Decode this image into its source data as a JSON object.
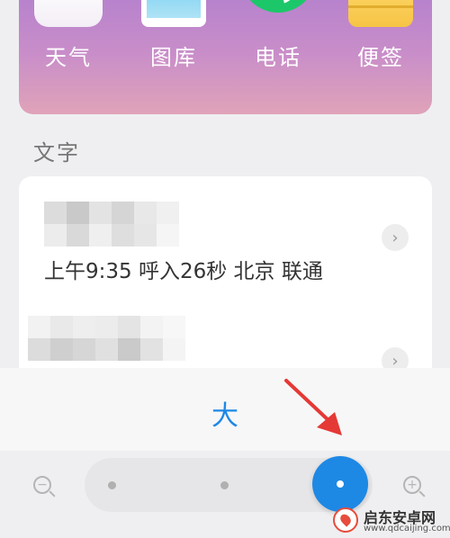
{
  "apps": [
    {
      "label": "天气",
      "icon": "weather-icon"
    },
    {
      "label": "图库",
      "icon": "gallery-icon"
    },
    {
      "label": "电话",
      "icon": "phone-icon"
    },
    {
      "label": "便签",
      "icon": "notes-icon"
    }
  ],
  "section": {
    "title": "文字"
  },
  "records": [
    {
      "detail": "上午9:35 呼入26秒 北京 联通"
    },
    {
      "detail": ""
    }
  ],
  "font_size": {
    "label": "大",
    "levels": 3,
    "selected_level": 3
  },
  "colors": {
    "accent": "#1e88e5",
    "panel_top": "#b27fce",
    "panel_bottom": "#e0a3b8",
    "arrow": "#e53935"
  },
  "watermark": {
    "title": "启东安卓网",
    "url": "www.qdcaijing.com"
  }
}
